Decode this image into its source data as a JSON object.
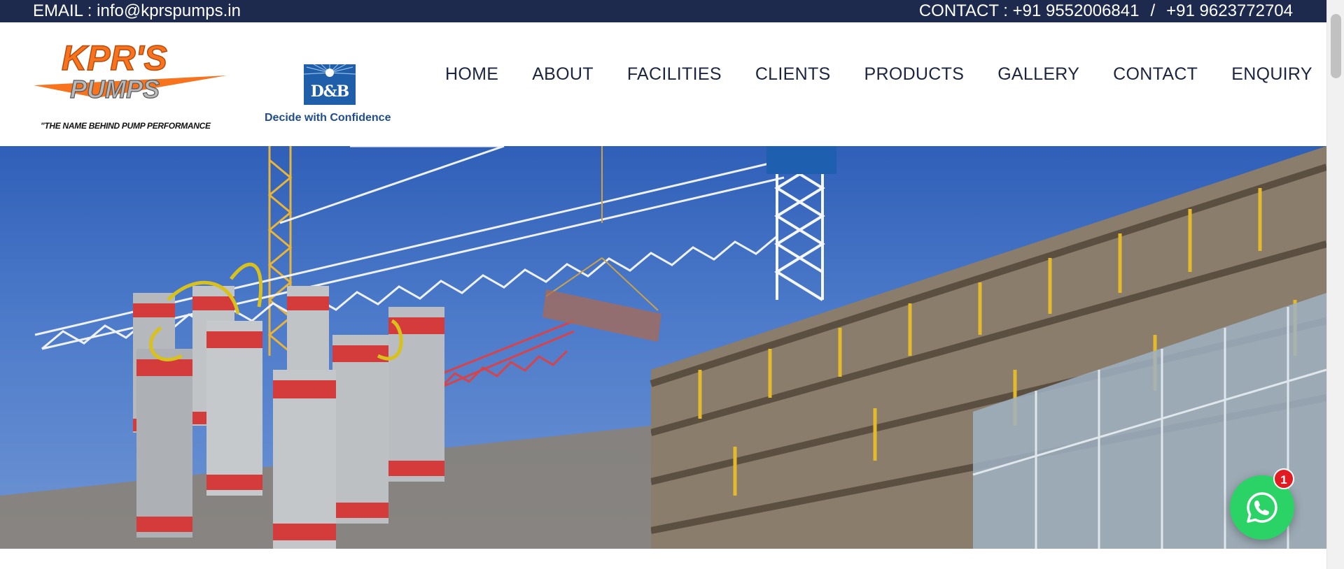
{
  "topbar": {
    "email_text": "EMAIL : info@kprspumps.in",
    "contact_label": "CONTACT : +91 9552006841",
    "contact_separator": "/",
    "contact_phone2": "+91 9623772704"
  },
  "brand": {
    "logo_line1": "KPR'S",
    "logo_line2": "PUMPS",
    "tagline": "\"THE NAME BEHIND PUMP PERFORMANCE",
    "partner_badge": "D&B",
    "partner_caption": "Decide with Confidence"
  },
  "nav": [
    {
      "label": "HOME"
    },
    {
      "label": "ABOUT"
    },
    {
      "label": "FACILITIES"
    },
    {
      "label": "CLIENTS"
    },
    {
      "label": "PRODUCTS"
    },
    {
      "label": "GALLERY"
    },
    {
      "label": "CONTACT"
    },
    {
      "label": "ENQUIRY"
    }
  ],
  "whatsapp": {
    "icon": "whatsapp-icon",
    "badge_count": "1"
  },
  "colors": {
    "topbar_bg": "#1d2a4d",
    "logo_orange": "#f7731e",
    "whatsapp_green": "#2bd366",
    "badge_red": "#e11b22"
  }
}
